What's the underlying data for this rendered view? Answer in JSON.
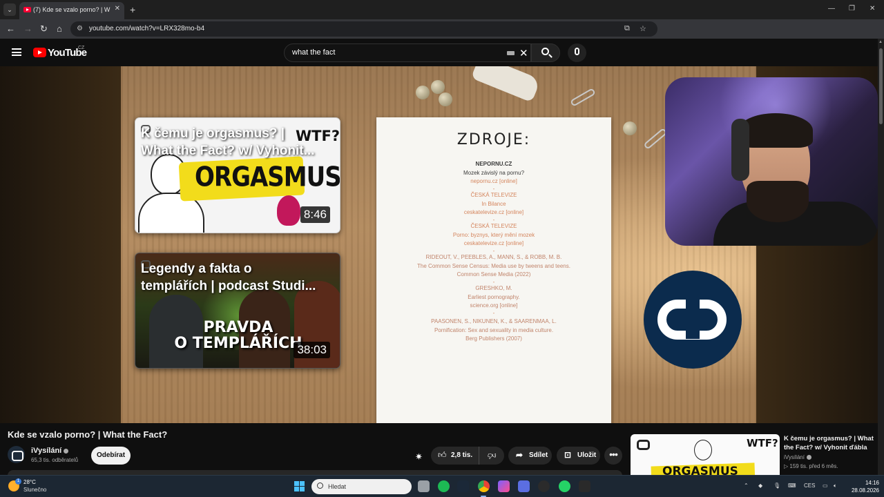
{
  "browser": {
    "tab_title": "(7) Kde se vzalo porno? | What the Fact?",
    "url": "youtube.com/watch?v=LRX328mo-b4"
  },
  "youtube": {
    "wordmark": "YouTube",
    "country": "CZ",
    "search_value": "what the fact"
  },
  "player": {
    "end_cards": [
      {
        "title_line1": "K čemu je orgasmus? |",
        "title_line2": "What the Fact? w/ Vyhonit...",
        "duration": "8:46",
        "art_word": "ORGASMUS",
        "art_mark": "WTF?"
      },
      {
        "title_line1": "Legendy a fakta o",
        "title_line2": "templářích | podcast Studi...",
        "duration": "38:03",
        "art_line1": "PRAVDA",
        "art_line2": "O TEMPLÁŘÍCH"
      }
    ],
    "sources": {
      "heading": "ZDROJE:",
      "blocks": [
        {
          "lines": [
            "NEPORNU.CZ",
            "Mozek závislý na pornu?",
            "nepornu.cz [online]"
          ],
          "style": "dark"
        },
        {
          "lines": [
            "ČESKÁ TELEVIZE",
            "In Bilance",
            "ceskatelevize.cz  [online]"
          ],
          "style": "light"
        },
        {
          "lines": [
            "ČESKÁ TELEVIZE",
            "Porno: byznys, který mění mozek",
            "ceskatelevize.cz  [online]"
          ],
          "style": "light"
        },
        {
          "lines": [
            "RIDEOUT, V., PEEBLES, A., MANN, S., & ROBB, M. B.",
            "The Common Sense Census: Media use by tweens and teens.",
            "Common Sense Media (2022)"
          ],
          "style": "mid"
        },
        {
          "lines": [
            "GRESHKO, M.",
            "Earliest pornography.",
            "science.org  [online]"
          ],
          "style": "mid"
        },
        {
          "lines": [
            "PAASONEN, S., NIKUNEN, K., & SAARENMAA, L.",
            "Pornification: Sex and sexuality in media culture.",
            "Berg Publishers (2007)"
          ],
          "style": "mid"
        }
      ]
    }
  },
  "video": {
    "title": "Kde se vzalo porno? | What the Fact?",
    "channel": "iVysílání",
    "subscribers": "65,3 tis. odběratelů",
    "subscribe_label": "Odebírat",
    "likes": "2,8 tis.",
    "share_label": "Sdílet",
    "save_label": "Uložit",
    "more_label": "•••"
  },
  "recommended": {
    "title": "K čemu je orgasmus? | What the Fact? w/ Vyhonit ďábla",
    "channel": "iVysílání",
    "meta": "▷ 159 tis.   před 6 měs.",
    "art_word": "ORGASMUS",
    "art_mark": "WTF?"
  },
  "taskbar": {
    "temperature": "28°C",
    "weather": "Slunečno",
    "weather_badge": "1",
    "search_placeholder": "Hledat",
    "language": "CES",
    "time": "14:16",
    "date": "28.08.2026"
  },
  "colors": {
    "youtube_red": "#ff0000",
    "ct_logo_blue": "#0b2b4d",
    "source_accent": "#d4845c",
    "windows_accent": "#4cc2ff"
  }
}
